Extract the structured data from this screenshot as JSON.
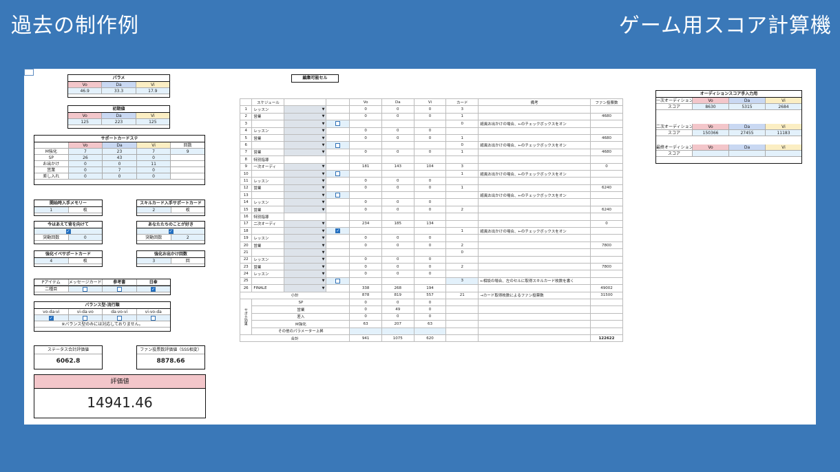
{
  "header": {
    "left": "過去の制作例",
    "right": "ゲーム用スコア計算機"
  },
  "edit_cell": "編集可能セル",
  "params": {
    "title": "パラメ",
    "cols": [
      "Vo",
      "Da",
      "Vi"
    ],
    "vals": [
      "46.9",
      "33.3",
      "17.9"
    ]
  },
  "initial": {
    "title": "初期値",
    "cols": [
      "Vo",
      "Da",
      "Vi"
    ],
    "vals": [
      "125",
      "223",
      "125"
    ]
  },
  "support": {
    "title": "サポートカードステ",
    "cols": [
      "",
      "Vo",
      "Da",
      "Vi",
      "回数"
    ],
    "rows": [
      [
        "M強化",
        "7",
        "23",
        "7",
        "9"
      ],
      [
        "SP",
        "26",
        "43",
        "0",
        ""
      ],
      [
        "お出かけ",
        "0",
        "0",
        "11",
        ""
      ],
      [
        "営業",
        "0",
        "7",
        "0",
        ""
      ],
      [
        "差し入れ",
        "0",
        "0",
        "0",
        ""
      ]
    ]
  },
  "mem": {
    "title": "開始時入手メモリー",
    "v": "1",
    "u": "枚"
  },
  "skill": {
    "title": "スキルカード入手サポートカード",
    "v": "2",
    "u": "枚"
  },
  "imahe": {
    "title": "今はあえて背を向けて",
    "sub": "突動回数",
    "v": "0"
  },
  "anata": {
    "title": "あなたたちのことが好き",
    "sub": "突動回数",
    "v": "2"
  },
  "kyouka": {
    "title": "強化イベサポートカード",
    "v": "4",
    "u": "枚"
  },
  "odekake": {
    "title": "強化お出かけ回数",
    "v": "3",
    "u": "回"
  },
  "items": {
    "cols": [
      "Pアイテム",
      "メッセージカード",
      "参考書",
      "日傘"
    ],
    "first": "二種目"
  },
  "balance": {
    "title": "バランス型-流行順",
    "cols": [
      "vo-da-vi",
      "vi-da-vo",
      "da-vo-vi",
      "vi-vo-da"
    ],
    "note": "※バランス型のみには対応しておりません。"
  },
  "status_eval": {
    "title": "ステータス合計評価値",
    "v": "6062.8"
  },
  "fan_eval": {
    "title": "ファン投票数評価値（SSS相変）",
    "v": "8878.66"
  },
  "score": {
    "title": "評価値",
    "v": "14941.46"
  },
  "main": {
    "headers": [
      "",
      "スケジュール",
      "",
      "",
      "Vo",
      "Da",
      "Vi",
      "カード",
      "備考",
      "ファン投票数"
    ],
    "rows": [
      [
        "1",
        "レッスン",
        "dd",
        "",
        "0",
        "0",
        "0",
        "3",
        "",
        ""
      ],
      [
        "2",
        "営業",
        "dd",
        "",
        "0",
        "0",
        "0",
        "1",
        "",
        "4680"
      ],
      [
        "3",
        "",
        "dd",
        "cb",
        "",
        "",
        "",
        "0",
        "紙風お出かけの場合、←のチェックボックスをオン",
        ""
      ],
      [
        "4",
        "レッスン",
        "dd",
        "",
        "0",
        "0",
        "0",
        "",
        "",
        ""
      ],
      [
        "5",
        "営業",
        "dd",
        "",
        "0",
        "0",
        "0",
        "1",
        "",
        "4680"
      ],
      [
        "6",
        "",
        "dd",
        "cb",
        "",
        "",
        "",
        "0",
        "紙風お出かけの場合、←のチェックボックスをオン",
        ""
      ],
      [
        "7",
        "営業",
        "dd",
        "",
        "0",
        "0",
        "0",
        "1",
        "",
        "4680"
      ],
      [
        "8",
        "特別指導",
        "",
        "",
        "",
        "",
        "",
        "",
        "",
        ""
      ],
      [
        "9",
        "一次オーディ",
        "dd",
        "",
        "181",
        "143",
        "104",
        "3",
        "",
        "0"
      ],
      [
        "10",
        "",
        "dd",
        "cb",
        "",
        "",
        "",
        "1",
        "紙風お出かけの場合、←のチェックボックスをオン",
        ""
      ],
      [
        "11",
        "レッスン",
        "dd",
        "",
        "0",
        "0",
        "0",
        "",
        "",
        ""
      ],
      [
        "12",
        "営業",
        "dd",
        "",
        "0",
        "0",
        "0",
        "1",
        "",
        "6240"
      ],
      [
        "13",
        "",
        "dd",
        "cb",
        "",
        "",
        "",
        "",
        "紙風お出かけの場合、←のチェックボックスをオン",
        ""
      ],
      [
        "14",
        "レッスン",
        "dd",
        "",
        "0",
        "0",
        "0",
        "",
        "",
        ""
      ],
      [
        "15",
        "営業",
        "dd",
        "",
        "0",
        "0",
        "0",
        "2",
        "",
        "6240"
      ],
      [
        "16",
        "特別指導",
        "",
        "",
        "",
        "",
        "",
        "",
        "",
        ""
      ],
      [
        "17",
        "二次オーディ",
        "dd",
        "",
        "234",
        "185",
        "134",
        "",
        "",
        "0"
      ],
      [
        "18",
        "",
        "dd",
        "cbon",
        "",
        "",
        "",
        "1",
        "紙風お出かけの場合、←のチェックボックスをオン",
        ""
      ],
      [
        "19",
        "レッスン",
        "dd",
        "",
        "0",
        "0",
        "0",
        "",
        "",
        ""
      ],
      [
        "20",
        "営業",
        "dd",
        "",
        "0",
        "0",
        "0",
        "2",
        "",
        "7800"
      ],
      [
        "21",
        "",
        "dd",
        "",
        "",
        "",
        "",
        "0",
        "",
        ""
      ],
      [
        "22",
        "レッスン",
        "dd",
        "",
        "0",
        "0",
        "0",
        "",
        "",
        ""
      ],
      [
        "23",
        "営業",
        "dd",
        "",
        "0",
        "0",
        "0",
        "2",
        "",
        "7800"
      ],
      [
        "24",
        "レッスン",
        "dd",
        "",
        "0",
        "0",
        "0",
        "",
        "",
        ""
      ],
      [
        "25",
        "",
        "dd",
        "cb",
        "",
        "",
        "",
        "3",
        "←相談の場合、左のセルに取得スキルカード枚数を書く",
        ""
      ],
      [
        "26",
        "FINALE",
        "dd",
        "",
        "338",
        "268",
        "194",
        "",
        "",
        "49002"
      ]
    ],
    "subtotal": [
      "小計",
      "878",
      "819",
      "557",
      "21",
      "→カード取得枚数によるファン投票数",
      "31500"
    ],
    "support_rows": [
      [
        "SP",
        "0",
        "0",
        "0"
      ],
      [
        "営業",
        "0",
        "49",
        "0"
      ],
      [
        "差入",
        "0",
        "0",
        "0"
      ],
      [
        "M強化",
        "63",
        "207",
        "63"
      ],
      [
        "その他のパラメーター上昇",
        "",
        "",
        ""
      ]
    ],
    "support_label": "サポカ効果",
    "total": [
      "合計",
      "941",
      "1075",
      "620",
      "",
      "",
      "122622"
    ]
  },
  "audition": {
    "title": "オーディションスコア手入力用",
    "cols": [
      "Vo",
      "Da",
      "Vi"
    ],
    "r1": {
      "name": "一次オーディション",
      "label": "スコア",
      "vals": [
        "8630",
        "5315",
        "2684"
      ]
    },
    "r2": {
      "name": "二次オーディション",
      "label": "スコア",
      "vals": [
        "150366",
        "27455",
        "11183"
      ]
    },
    "r3": {
      "name": "最終オーディション",
      "label": "スコア",
      "vals": [
        "",
        "",
        ""
      ]
    }
  }
}
